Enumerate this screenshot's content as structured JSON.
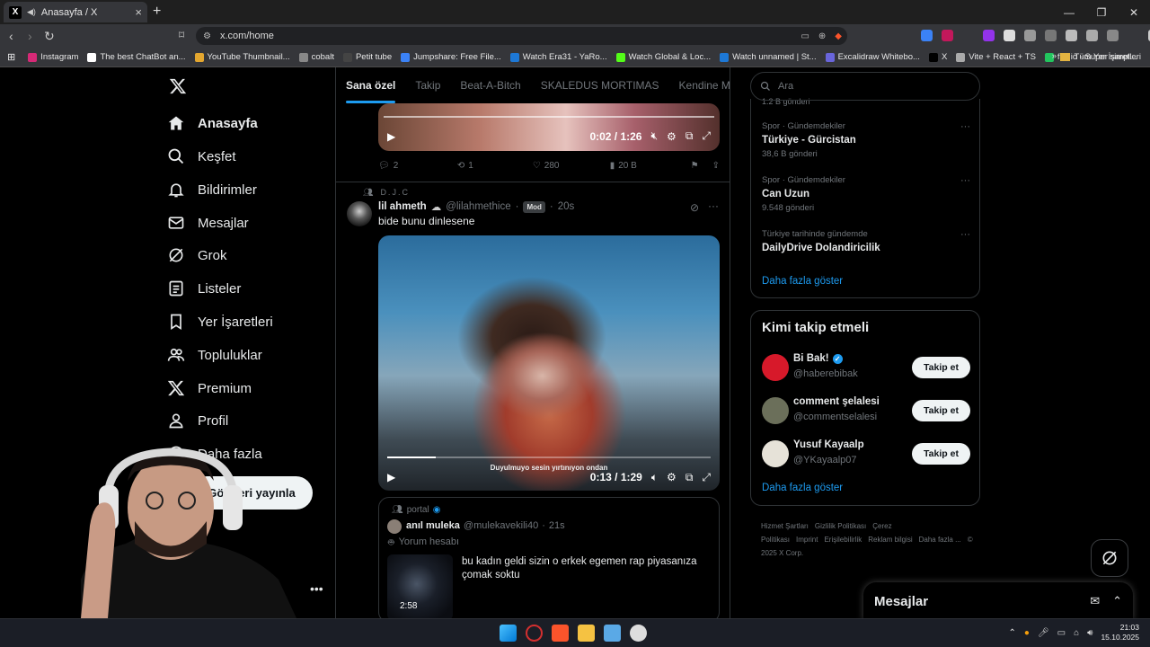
{
  "browser": {
    "tab_title": "Anasayfa / X",
    "url": "x.com/home",
    "bookmarks": [
      {
        "label": "Instagram",
        "color": "#d62976"
      },
      {
        "label": "The best ChatBot an...",
        "color": "#ffffff"
      },
      {
        "label": "YouTube Thumbnail...",
        "color": "#e3a62f"
      },
      {
        "label": "cobalt",
        "color": "#888888"
      },
      {
        "label": "Petit tube",
        "color": "#444444"
      },
      {
        "label": "Jumpshare: Free File...",
        "color": "#3b82f6"
      },
      {
        "label": "Watch Era31 - YaRo...",
        "color": "#1d78d6"
      },
      {
        "label": "Watch Global & Loc...",
        "color": "#53fc18"
      },
      {
        "label": "Watch unnamed | St...",
        "color": "#1d78d6"
      },
      {
        "label": "Excalidraw Whitebo...",
        "color": "#6965db"
      },
      {
        "label": "X",
        "color": "#000000"
      },
      {
        "label": "Vite + React + TS",
        "color": "#aaaaaa"
      },
      {
        "label": "file.io - Super simpl...",
        "color": "#22c55e"
      }
    ],
    "all_bookmarks": "Tüm Yer İşaretleri"
  },
  "nav": {
    "items": [
      {
        "label": "Anasayfa",
        "icon": "home-icon"
      },
      {
        "label": "Keşfet",
        "icon": "search-icon"
      },
      {
        "label": "Bildirimler",
        "icon": "bell-icon"
      },
      {
        "label": "Mesajlar",
        "icon": "mail-icon"
      },
      {
        "label": "Grok",
        "icon": "grok-icon"
      },
      {
        "label": "Listeler",
        "icon": "list-icon"
      },
      {
        "label": "Yer İşaretleri",
        "icon": "bookmark-icon"
      },
      {
        "label": "Topluluklar",
        "icon": "people-icon"
      },
      {
        "label": "Premium",
        "icon": "x-logo-icon"
      },
      {
        "label": "Profil",
        "icon": "person-icon"
      },
      {
        "label": "Daha fazla",
        "icon": "more-circle-icon"
      }
    ],
    "post_button": "Gönderi yayınla"
  },
  "feed": {
    "tabs": [
      "Sana özel",
      "Takip",
      "Beat-A-Bitch",
      "SKALEDUS MORTIMAS",
      "Kendine Müz"
    ],
    "post1": {
      "video_time": "0:02 / 1:26",
      "replies": "2",
      "reposts": "1",
      "likes": "280",
      "views": "20 B"
    },
    "post2": {
      "community": "D.J.C",
      "name": "lil ahmeth",
      "handle": "@lilahmethice",
      "badge": "Mod",
      "time": "20s",
      "text": "bide bunu dinlesene",
      "video_time": "0:13 / 1:29",
      "video_caption": "Duyulmuyo sesin yırtınıyon ondan",
      "progress": 0.15
    },
    "quote": {
      "community": "portal",
      "name": "anıl muleka",
      "handle": "@mulekavekili40",
      "time": "21s",
      "label": "Yorum hesabı",
      "text": "bu kadın geldi sizin o erkek egemen rap piyasanıza çomak soktu",
      "duration": "2:58"
    }
  },
  "right": {
    "search_placeholder": "Ara",
    "partial_text": "1.2 B gönderi",
    "trends": [
      {
        "category": "Spor · Gündemdekiler",
        "name": "Türkiye - Gürcistan",
        "count": "38,6 B gönderi"
      },
      {
        "category": "Spor · Gündemdekiler",
        "name": "Can Uzun",
        "count": "9.548 gönderi"
      },
      {
        "category": "Türkiye tarihinde gündemde",
        "name": "DailyDrive Dolandiricilik",
        "count": ""
      }
    ],
    "show_more": "Daha fazla göster",
    "who_title": "Kimi takip etmeli",
    "who": [
      {
        "name": "Bi Bak!",
        "handle": "@haberebibak",
        "verified": true,
        "avatar_color": "#d7192a"
      },
      {
        "name": "comment şelalesi",
        "handle": "@commentselalesi",
        "verified": false,
        "avatar_color": "#6b6f5a"
      },
      {
        "name": "Yusuf Kayaalp",
        "handle": "@YKayaalp07",
        "verified": false,
        "avatar_color": "#e6e2d8"
      }
    ],
    "follow_label": "Takip et",
    "who_show_more": "Daha fazla göster",
    "footer": [
      "Hizmet Şartları",
      "Gizlilik Politikası",
      "Çerez Politikası",
      "Imprint",
      "Erişilebilirlik",
      "Reklam bilgisi",
      "Daha fazla ...",
      "© 2025 X Corp."
    ],
    "messages_title": "Mesajlar"
  },
  "taskbar": {
    "time": "21:03",
    "date": "15.10.2025"
  }
}
